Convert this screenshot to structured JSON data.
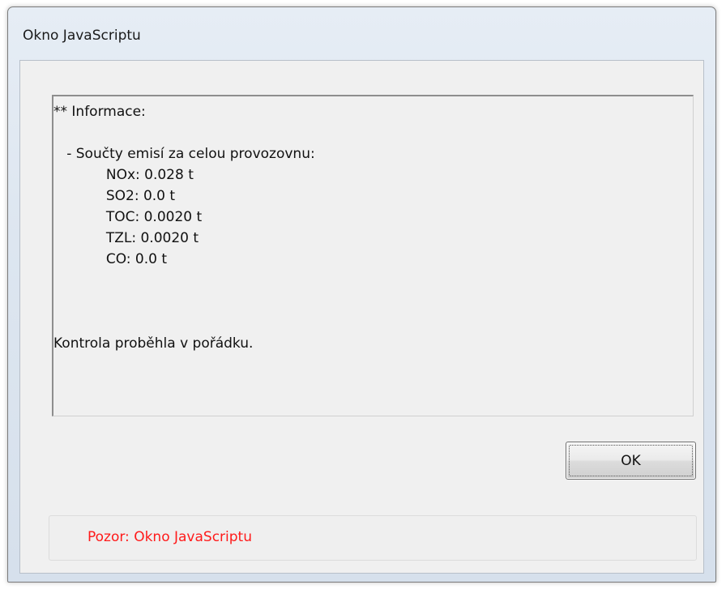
{
  "window": {
    "title": "Okno JavaScriptu"
  },
  "message": {
    "lines": [
      "** Informace:",
      "",
      "   - Součty emisí za celou provozovnu:",
      "            NOx: 0.028 t",
      "            SO2: 0.0 t",
      "            TOC: 0.0020 t",
      "            TZL: 0.0020 t",
      "            CO: 0.0 t",
      "",
      "",
      "",
      "Kontrola proběhla v pořádku."
    ]
  },
  "buttons": {
    "ok_label": "OK"
  },
  "warning": {
    "text": "Pozor: Okno JavaScriptu",
    "color": "#ff1a1a"
  }
}
